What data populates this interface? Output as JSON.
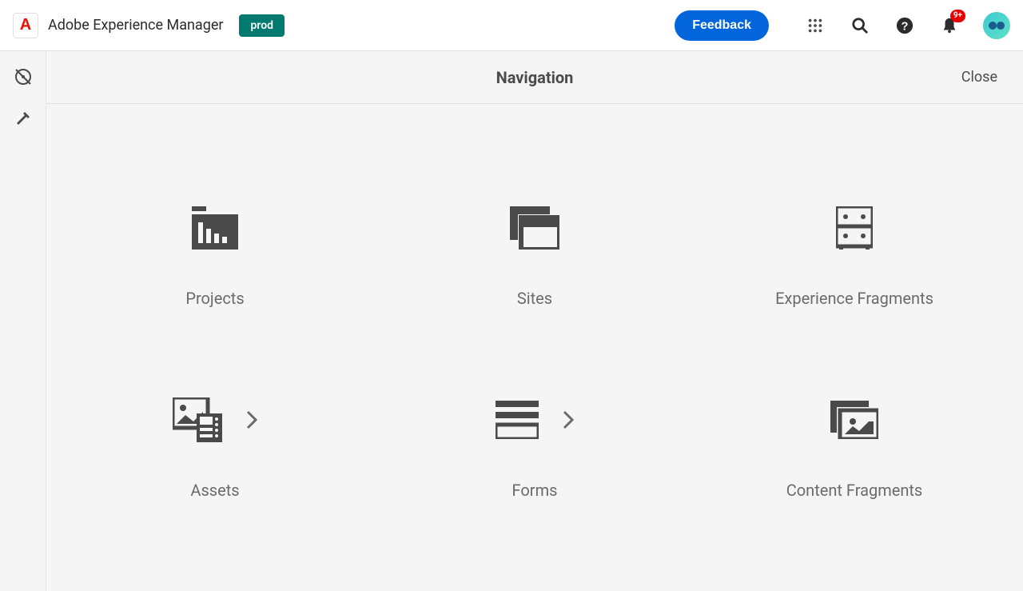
{
  "header": {
    "app_title": "Adobe Experience Manager",
    "env_badge": "prod",
    "feedback_label": "Feedback",
    "notification_count": "9+"
  },
  "nav_header": {
    "title": "Navigation",
    "close_label": "Close"
  },
  "cards": [
    {
      "label": "Projects",
      "icon": "projects",
      "has_more": false
    },
    {
      "label": "Sites",
      "icon": "sites",
      "has_more": false
    },
    {
      "label": "Experience Fragments",
      "icon": "experience-fragments",
      "has_more": false
    },
    {
      "label": "Assets",
      "icon": "assets",
      "has_more": true
    },
    {
      "label": "Forms",
      "icon": "forms",
      "has_more": true
    },
    {
      "label": "Content Fragments",
      "icon": "content-fragments",
      "has_more": false
    }
  ]
}
